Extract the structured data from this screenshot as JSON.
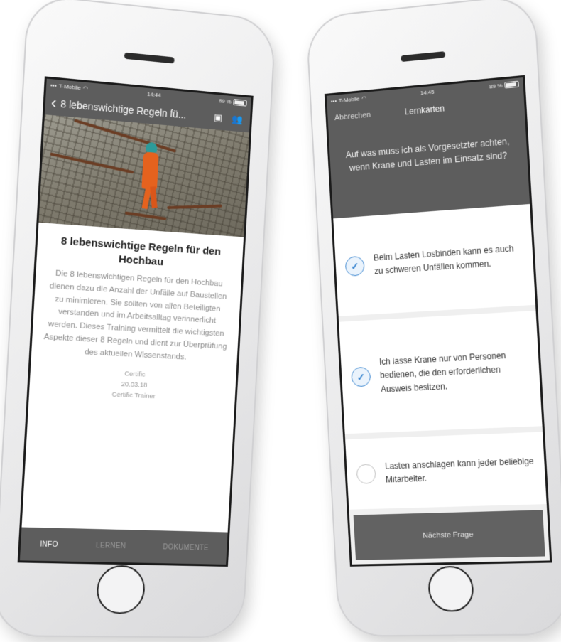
{
  "left_phone": {
    "status": {
      "carrier": "T-Mobile",
      "time": "14:44",
      "battery": "89 %"
    },
    "nav": {
      "back_icon": "chevron-left-icon",
      "title": "8 lebenswichtige Regeln fü...",
      "chat_icon": "chat-icon",
      "people_icon": "people-icon"
    },
    "course": {
      "title": "8 lebenswichtige Regeln für den Hochbau",
      "description": "Die 8 lebenswichtigen Regeln für den Hochbau dienen dazu die Anzahl der Unfälle auf Baustellen zu minimieren. Sie sollten von allen Beteiligten verstanden und im Arbeitsalltag verinnerlicht werden. Dieses Training vermittelt die wichtigsten Aspekte dieser 8 Regeln und dient zur Überprüfung des aktuellen Wissenstands.",
      "author": "Certific",
      "date": "20.03.18",
      "trainer": "Certific Trainer"
    },
    "tabs": [
      "INFO",
      "LERNEN",
      "DOKUMENTE"
    ]
  },
  "right_phone": {
    "status": {
      "carrier": "T-Mobile",
      "time": "14:45",
      "battery": "89 %"
    },
    "nav": {
      "cancel": "Abbrechen",
      "title": "Lernkarten"
    },
    "question": "Auf was muss ich als Vorgesetzter achten, wenn Krane und Lasten im Einsatz sind?",
    "answers": [
      {
        "text": "Beim Lasten Losbinden kann es auch zu schweren Unfällen kommen.",
        "checked": true
      },
      {
        "text": "Ich lasse Krane nur von Personen bedienen, die den erforderlichen Ausweis besitzen.",
        "checked": true
      },
      {
        "text": "Lasten anschlagen kann jeder beliebige Mitarbeiter.",
        "checked": false
      }
    ],
    "next_button": "Nächste Frage"
  },
  "colors": {
    "header_gray": "#5d5d5d",
    "accent_blue": "#3a86d0",
    "worker_orange": "#e5621e"
  }
}
